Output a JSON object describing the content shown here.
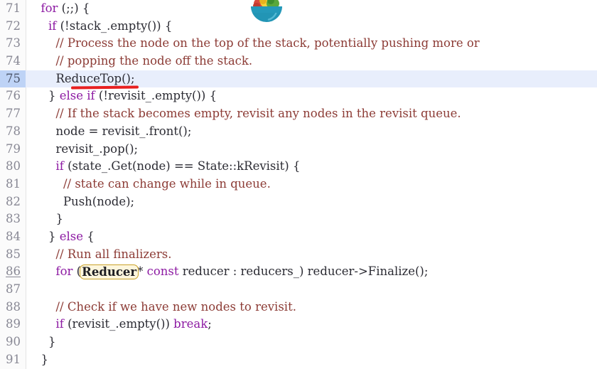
{
  "editor": {
    "language": "cpp",
    "current_line": 75,
    "colors": {
      "background": "#ffffff",
      "gutter_background": "#fbfbfb",
      "line_number": "#888894",
      "current_line_highlight": "#e8eefc",
      "current_line_gutter": "#bed3f6",
      "keyword": "#8d1ba3",
      "comment": "#8c3b35",
      "plain_text": "#2b2b33",
      "annotation_red": "#e82020",
      "annotation_box_border": "#c9a227",
      "annotation_box_fill": "#fdf6dd"
    },
    "lines": [
      {
        "number": "71",
        "current": false,
        "number_underlined": false,
        "tokens": [
          {
            "text": "  ",
            "kind": "plain"
          },
          {
            "text": "for",
            "kind": "keyword"
          },
          {
            "text": " (;;) {",
            "kind": "plain"
          }
        ]
      },
      {
        "number": "72",
        "current": false,
        "number_underlined": false,
        "tokens": [
          {
            "text": "    ",
            "kind": "plain"
          },
          {
            "text": "if",
            "kind": "keyword"
          },
          {
            "text": " (!stack_.empty()) {",
            "kind": "plain"
          }
        ]
      },
      {
        "number": "73",
        "current": false,
        "number_underlined": false,
        "tokens": [
          {
            "text": "      ",
            "kind": "plain"
          },
          {
            "text": "// Process the node on the top of the stack, potentially pushing more or",
            "kind": "comment"
          }
        ]
      },
      {
        "number": "74",
        "current": false,
        "number_underlined": false,
        "tokens": [
          {
            "text": "      ",
            "kind": "plain"
          },
          {
            "text": "// popping the node off the stack.",
            "kind": "comment"
          }
        ]
      },
      {
        "number": "75",
        "current": true,
        "number_underlined": false,
        "tokens": [
          {
            "text": "      ReduceTop();",
            "kind": "plain"
          }
        ]
      },
      {
        "number": "76",
        "current": false,
        "number_underlined": false,
        "tokens": [
          {
            "text": "    } ",
            "kind": "plain"
          },
          {
            "text": "else",
            "kind": "keyword"
          },
          {
            "text": " ",
            "kind": "plain"
          },
          {
            "text": "if",
            "kind": "keyword"
          },
          {
            "text": " (!revisit_.empty()) {",
            "kind": "plain"
          }
        ]
      },
      {
        "number": "77",
        "current": false,
        "number_underlined": false,
        "tokens": [
          {
            "text": "      ",
            "kind": "plain"
          },
          {
            "text": "// If the stack becomes empty, revisit any nodes in the revisit queue.",
            "kind": "comment"
          }
        ]
      },
      {
        "number": "78",
        "current": false,
        "number_underlined": false,
        "tokens": [
          {
            "text": "      node = revisit_.front();",
            "kind": "plain"
          }
        ]
      },
      {
        "number": "79",
        "current": false,
        "number_underlined": false,
        "tokens": [
          {
            "text": "      revisit_.pop();",
            "kind": "plain"
          }
        ]
      },
      {
        "number": "80",
        "current": false,
        "number_underlined": false,
        "tokens": [
          {
            "text": "      ",
            "kind": "plain"
          },
          {
            "text": "if",
            "kind": "keyword"
          },
          {
            "text": " (state_.Get(node) == State::kRevisit) {",
            "kind": "plain"
          }
        ]
      },
      {
        "number": "81",
        "current": false,
        "number_underlined": false,
        "tokens": [
          {
            "text": "        ",
            "kind": "plain"
          },
          {
            "text": "// state can change while in queue.",
            "kind": "comment"
          }
        ]
      },
      {
        "number": "82",
        "current": false,
        "number_underlined": false,
        "tokens": [
          {
            "text": "        Push(node);",
            "kind": "plain"
          }
        ]
      },
      {
        "number": "83",
        "current": false,
        "number_underlined": false,
        "tokens": [
          {
            "text": "      }",
            "kind": "plain"
          }
        ]
      },
      {
        "number": "84",
        "current": false,
        "number_underlined": false,
        "tokens": [
          {
            "text": "    } ",
            "kind": "plain"
          },
          {
            "text": "else",
            "kind": "keyword"
          },
          {
            "text": " {",
            "kind": "plain"
          }
        ]
      },
      {
        "number": "85",
        "current": false,
        "number_underlined": false,
        "tokens": [
          {
            "text": "      ",
            "kind": "plain"
          },
          {
            "text": "// Run all finalizers.",
            "kind": "comment"
          }
        ]
      },
      {
        "number": "86",
        "current": false,
        "number_underlined": true,
        "tokens": [
          {
            "text": "      ",
            "kind": "plain"
          },
          {
            "text": "for",
            "kind": "keyword"
          },
          {
            "text": " (",
            "kind": "plain"
          },
          {
            "text": "Reducer",
            "kind": "boxed"
          },
          {
            "text": "* ",
            "kind": "plain"
          },
          {
            "text": "const",
            "kind": "keyword"
          },
          {
            "text": " reducer : reducers_) reducer->Finalize();",
            "kind": "plain"
          }
        ]
      },
      {
        "number": "87",
        "current": false,
        "number_underlined": false,
        "tokens": [
          {
            "text": "",
            "kind": "plain"
          }
        ]
      },
      {
        "number": "88",
        "current": false,
        "number_underlined": false,
        "tokens": [
          {
            "text": "      ",
            "kind": "plain"
          },
          {
            "text": "// Check if we have new nodes to revisit.",
            "kind": "comment"
          }
        ]
      },
      {
        "number": "89",
        "current": false,
        "number_underlined": false,
        "tokens": [
          {
            "text": "      ",
            "kind": "plain"
          },
          {
            "text": "if",
            "kind": "keyword"
          },
          {
            "text": " (revisit_.empty()) ",
            "kind": "plain"
          },
          {
            "text": "break",
            "kind": "keyword"
          },
          {
            "text": ";",
            "kind": "plain"
          }
        ]
      },
      {
        "number": "90",
        "current": false,
        "number_underlined": false,
        "tokens": [
          {
            "text": "    }",
            "kind": "plain"
          }
        ]
      },
      {
        "number": "91",
        "current": false,
        "number_underlined": false,
        "tokens": [
          {
            "text": "  }",
            "kind": "plain"
          }
        ]
      }
    ]
  },
  "annotations": {
    "red_underline": {
      "target_text": "ReduceTop",
      "line_number": "75"
    },
    "boxed_identifier": {
      "text": "Reducer",
      "line_number": "86"
    }
  },
  "overlay_icon": {
    "name": "salad-bowl-icon",
    "bowl_color": "#2295b5",
    "bowl_shade": "#1a7e9c",
    "contents": [
      "#d94a3d",
      "#e8b21f",
      "#f2d23a",
      "#5aa83c",
      "#3f8f2e"
    ]
  }
}
